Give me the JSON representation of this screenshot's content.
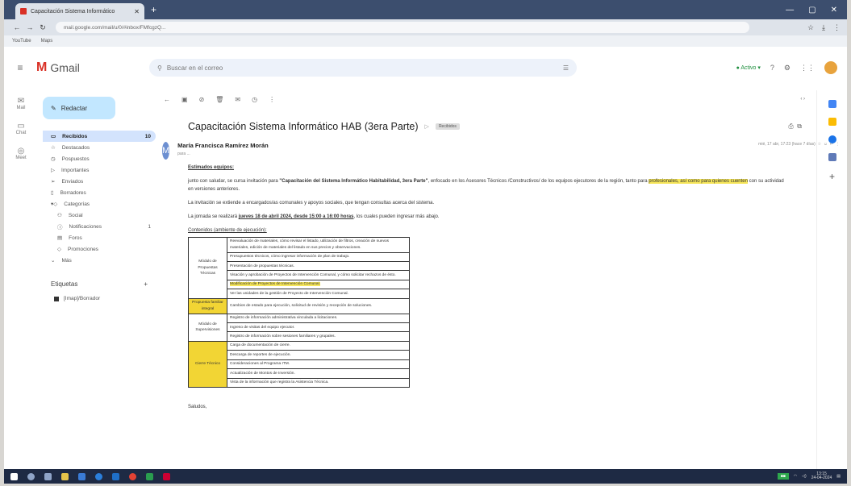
{
  "browser": {
    "tab_title": "Capacitación Sistema Informático",
    "url": "mail.google.com/mail/u/0/#inbox/FMfcgzQ...",
    "bookmarks": [
      "YouTube",
      "Maps"
    ],
    "icons": [
      "back-icon",
      "forward-icon",
      "reload-icon"
    ]
  },
  "gmail": {
    "product_name": "Gmail",
    "search_placeholder": "Buscar en el correo",
    "status": "Activo"
  },
  "rail": [
    {
      "label": "Mail",
      "icon": "mail-icon"
    },
    {
      "label": "Chat",
      "icon": "chat-icon"
    },
    {
      "label": "Meet",
      "icon": "video-icon"
    }
  ],
  "sidebar": {
    "compose": "Redactar",
    "items": [
      {
        "label": "Recibidos",
        "count": "10",
        "selected": true
      },
      {
        "label": "Destacados"
      },
      {
        "label": "Pospuestos"
      },
      {
        "label": "Importantes"
      },
      {
        "label": "Enviados"
      },
      {
        "label": "Borradores"
      },
      {
        "label": "Categorías"
      }
    ],
    "subitems": [
      {
        "label": "Social"
      },
      {
        "label": "Notificaciones",
        "count": "1"
      },
      {
        "label": "Foros"
      },
      {
        "label": "Promociones"
      }
    ],
    "more": "Más",
    "labels_title": "Etiquetas",
    "label_items": [
      "[Imap]/Borrador"
    ]
  },
  "email": {
    "subject": "Capacitación Sistema Informático HAB (3era Parte)",
    "badge": "Recibidos",
    "sender_name": "María Francisca Ramírez Morán",
    "sender_initial": "M",
    "date": "mié, 17 abr, 17:23 (hace 7 días)",
    "greeting": "Estimados equipos:",
    "p1_pre": "junto con saludar, se cursa invitación para ",
    "p1_bold": "\"Capacitación del Sistema Informático Habitabilidad, 3era Parte\"",
    "p1_post": ", enfocado en los Asesores Técnicos /Constructivos/ de los equipos ejecutores de la región, tanto para",
    "p1_hl": "profesionales, así como para quienes cuenten",
    "p1_end": " con su actividad en versiones anteriores.",
    "p2": "La invitación se extiende a encargados/as comunales y apoyos sociales, que tengan consultas acerca del sistema.",
    "p3_pre": "La jornada se realizará ",
    "p3_bold": "jueves 18 de abril 2024, desde 15:00 a 16:00 horas",
    "p3_post": ", los cuales pueden ingresar más abajo.",
    "table_title": "Contenidos (ambiente de ejecución):",
    "sign_off": "Saludos,"
  },
  "contents_table": [
    {
      "module": "Módulo de Propuestas Técnicas",
      "highlight": false,
      "rows": [
        "Reevaluación de materiales, cómo revisar el listado, utilización de filtros, creación de nuevos materiales, edición de materiales del listado en sus precios y observaciones.",
        "Presupuestos técnicos, cómo ingresar información de plan de trabajo.",
        "Presentación de propuestas técnicas.",
        "Visación y aprobación de Proyectos de Intervención Comunal, y cómo solicitar rechazos de ésto.",
        "Modificación de Proyectos de Intervención Comunal.",
        "Ver las unidades de la gestión de Proyecto de Intervención Comunal."
      ],
      "hl_rows": [
        4
      ]
    },
    {
      "module": "Propuesta familiar integral",
      "highlight": true,
      "rows": [
        "Cambios de estado para ejecución, solicitud de revisión y recepción de soluciones."
      ],
      "hl_rows": []
    },
    {
      "module": "Módulo de Supervisiones",
      "highlight": false,
      "rows": [
        "Registro de información administrativa vinculada a licitaciones.",
        "Ingreso de visitas del equipo ejecutor.",
        "Registro de información sobre sesiones familiares y grupales."
      ],
      "hl_rows": []
    },
    {
      "module": "Cierre Técnico",
      "highlight": true,
      "rows": [
        "Carga de documentación de cierre.",
        "Descarga de reportes de ejecución.",
        "Consideraciones al Programa ITM.",
        "Actualización de Montos de Inversión.",
        "Vista de la información que registra la Asistencia Técnica."
      ],
      "hl_rows": []
    }
  ],
  "taskbar": {
    "time": "13:15",
    "date": "24-04-2024"
  }
}
